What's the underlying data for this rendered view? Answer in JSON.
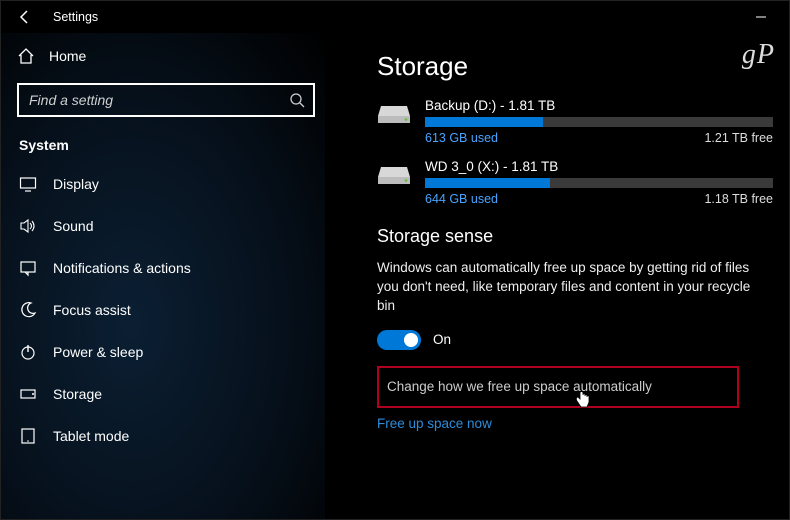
{
  "window": {
    "title": "Settings"
  },
  "logo": "gP",
  "sidebar": {
    "home": "Home",
    "search_placeholder": "Find a setting",
    "group": "System",
    "items": [
      {
        "label": "Display"
      },
      {
        "label": "Sound"
      },
      {
        "label": "Notifications & actions"
      },
      {
        "label": "Focus assist"
      },
      {
        "label": "Power & sleep"
      },
      {
        "label": "Storage"
      },
      {
        "label": "Tablet mode"
      }
    ]
  },
  "page": {
    "title": "Storage",
    "drives": [
      {
        "title": "Backup (D:) - 1.81 TB",
        "used": "613 GB used",
        "free": "1.21 TB free",
        "fill_pct": 34
      },
      {
        "title": "WD 3_0 (X:) - 1.81 TB",
        "used": "644 GB used",
        "free": "1.18 TB free",
        "fill_pct": 36
      }
    ],
    "sense": {
      "heading": "Storage sense",
      "description": "Windows can automatically free up space by getting rid of files you don't need, like temporary files and content in your recycle bin",
      "toggle_state": "On",
      "link_change": "Change how we free up space automatically",
      "link_freeup": "Free up space now"
    }
  }
}
